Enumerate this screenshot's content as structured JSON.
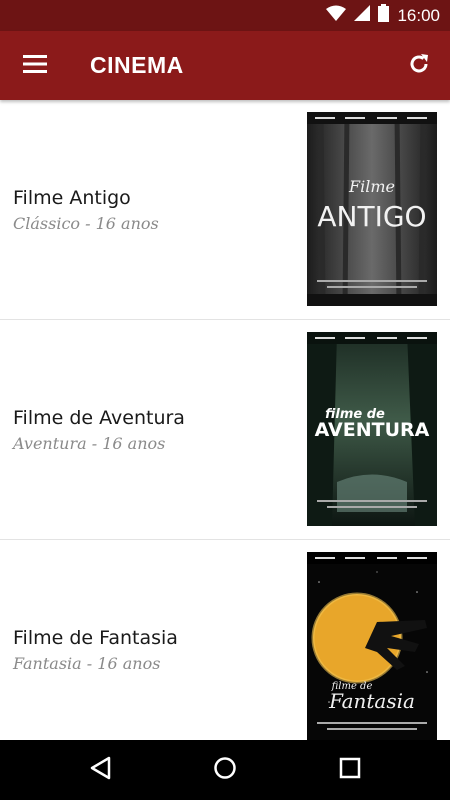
{
  "status_bar": {
    "time": "16:00"
  },
  "app_bar": {
    "title": "CINEMA"
  },
  "movies": [
    {
      "title": "Filme Antigo",
      "subtitle": "Clássico - 16 anos",
      "poster_title_small": "Filme",
      "poster_title_big": "ANTIGO"
    },
    {
      "title": "Filme de Aventura",
      "subtitle": "Aventura - 16 anos",
      "poster_title_small": "filme de",
      "poster_title_big": "AVENTURA"
    },
    {
      "title": "Filme de Fantasia",
      "subtitle": "Fantasia - 16 anos",
      "poster_title_small": "filme de",
      "poster_title_big": "Fantasia"
    }
  ],
  "colors": {
    "status_bar": "#6d1414",
    "app_bar": "#8b1a1a",
    "nav_bar": "#000000"
  },
  "icons": [
    "wifi-icon",
    "signal-icon",
    "battery-icon",
    "menu-icon",
    "refresh-icon",
    "back-icon",
    "home-icon",
    "recents-icon"
  ]
}
